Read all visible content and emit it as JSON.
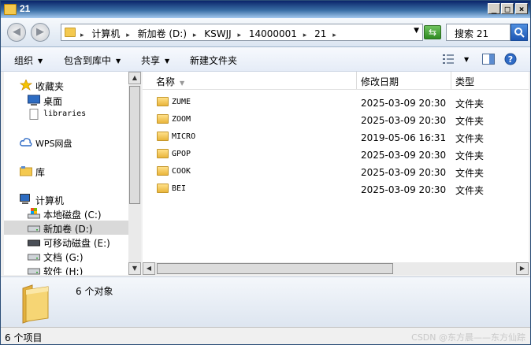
{
  "window": {
    "title": "21",
    "buttons": {
      "minimize": "_",
      "maximize": "□",
      "close": "×"
    }
  },
  "address": {
    "breadcrumbs": [
      "计算机",
      "新加卷 (D:)",
      "KSWJJ",
      "14000001",
      "21"
    ],
    "search_placeholder": "搜索 21"
  },
  "toolbar": {
    "organize": "组织",
    "include_in_library": "包含到库中",
    "share": "共享",
    "new_folder": "新建文件夹"
  },
  "nav": {
    "favorites": "收藏夹",
    "desktop": "桌面",
    "libraries_item": "libraries",
    "wps": "WPS网盘",
    "library": "库",
    "computer": "计算机",
    "drives": [
      {
        "label": "本地磁盘 (C:)"
      },
      {
        "label": "新加卷 (D:)",
        "selected": true
      },
      {
        "label": "可移动磁盘 (E:)"
      },
      {
        "label": "文档 (G:)"
      },
      {
        "label": "软件 (H:)"
      }
    ]
  },
  "columns": {
    "name": "名称",
    "modified": "修改日期",
    "type": "类型"
  },
  "files": [
    {
      "name": "ZUME",
      "modified": "2025-03-09 20:30",
      "type": "文件夹"
    },
    {
      "name": "ZOOM",
      "modified": "2025-03-09 20:30",
      "type": "文件夹"
    },
    {
      "name": "MICRO",
      "modified": "2019-05-06 16:31",
      "type": "文件夹"
    },
    {
      "name": "GPOP",
      "modified": "2025-03-09 20:30",
      "type": "文件夹"
    },
    {
      "name": "COOK",
      "modified": "2025-03-09 20:30",
      "type": "文件夹"
    },
    {
      "name": "BEI",
      "modified": "2025-03-09 20:30",
      "type": "文件夹"
    }
  ],
  "details": {
    "count_text": "6 个对象"
  },
  "status": {
    "items_text": "6 个项目",
    "watermark": "CSDN @东方晨——东方仙踪"
  },
  "colors": {
    "title_bar": "#0a246a",
    "folder_yellow": "#f4c94f",
    "selected_row": "#d9d9d9"
  }
}
